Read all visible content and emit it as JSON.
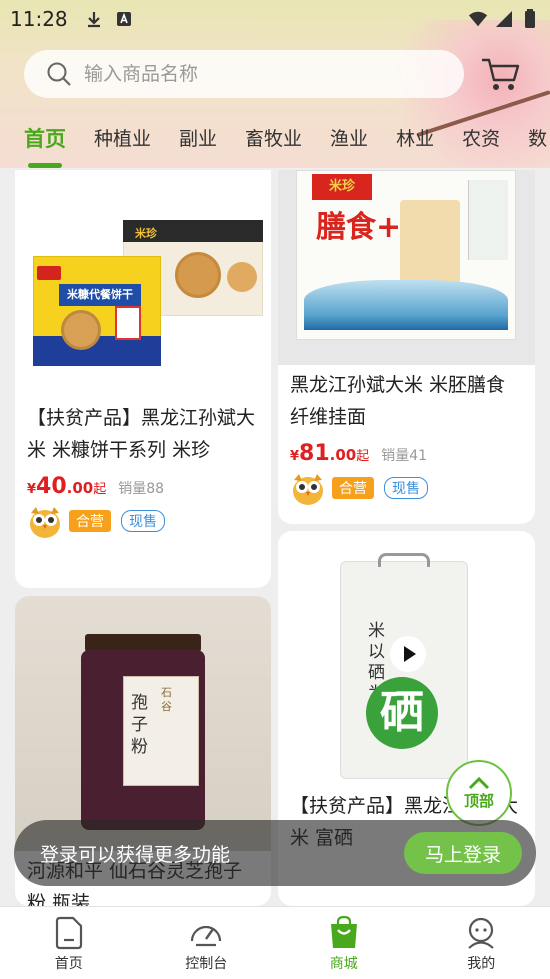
{
  "status_bar": {
    "time": "11:28"
  },
  "search": {
    "placeholder": "输入商品名称"
  },
  "tabs": [
    {
      "label": "首页",
      "active": true
    },
    {
      "label": "种植业"
    },
    {
      "label": "副业"
    },
    {
      "label": "畜牧业"
    },
    {
      "label": "渔业"
    },
    {
      "label": "林业"
    },
    {
      "label": "农资"
    },
    {
      "label": "数"
    }
  ],
  "products": [
    {
      "image_text_a": "米糠代餐饼干",
      "image_text_b": "米珍",
      "title": "【扶贫产品】黑龙江孙斌大米 米糠饼干系列 米珍",
      "yen": "¥",
      "price_int": "40",
      "price_dec": ".00",
      "qi": "起",
      "sales": "销量88",
      "badge1": "合营",
      "badge2": "现售"
    },
    {
      "image_text_a": "米珍",
      "image_text_b": "膳食+",
      "title": "黑龙江孙斌大米 米胚膳食纤维挂面",
      "yen": "¥",
      "price_int": "81",
      "price_dec": ".00",
      "qi": "起",
      "sales": "销量41",
      "badge1": "合营",
      "badge2": "现售"
    },
    {
      "image_text_a": "孢子粉",
      "image_text_b": "石谷",
      "title": "河源和平 仙石谷灵芝孢子粉 瓶装"
    },
    {
      "image_text_a": "米以硒为贵",
      "image_text_b": "硒",
      "title": "【扶贫产品】黑龙江孙斌大米 富硒"
    }
  ],
  "top_button": {
    "label": "顶部"
  },
  "login_bar": {
    "text": "登录可以获得更多功能",
    "button": "马上登录"
  },
  "bottom_nav": [
    {
      "label": "首页"
    },
    {
      "label": "控制台"
    },
    {
      "label": "商城",
      "active": true
    },
    {
      "label": "我的"
    }
  ],
  "colors": {
    "accent": "#4aa81c",
    "price": "#e02020",
    "badge_orange": "#f7a01c",
    "badge_blue": "#3d8fd8"
  }
}
